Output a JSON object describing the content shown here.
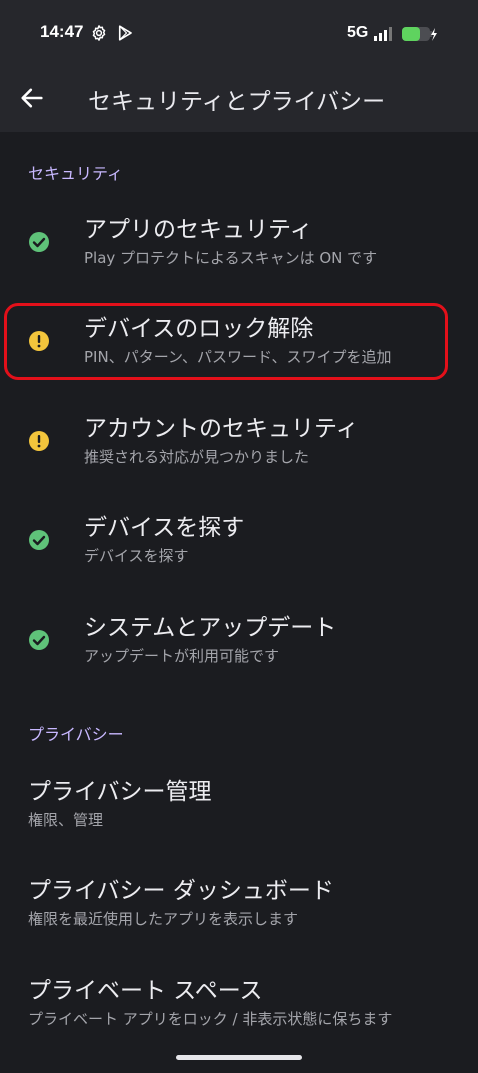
{
  "status_bar": {
    "time": "14:47",
    "network": "5G",
    "icons": [
      "settings-gear-icon",
      "play-store-icon",
      "signal-icon",
      "battery-charging-icon"
    ]
  },
  "app_bar": {
    "title": "セキュリティとプライバシー",
    "back_icon": "arrow-back-icon"
  },
  "security": {
    "header": "セキュリティ",
    "items": [
      {
        "label": "アプリのセキュリティ",
        "sub": "Play プロテクトによるスキャンは ON です",
        "status": "ok"
      },
      {
        "label": "デバイスのロック解除",
        "sub": "PIN、パターン、パスワード、スワイプを追加",
        "status": "warning"
      },
      {
        "label": "アカウントのセキュリティ",
        "sub": "推奨される対応が見つかりました",
        "status": "warning"
      },
      {
        "label": "デバイスを探す",
        "sub": "デバイスを探す",
        "status": "ok"
      },
      {
        "label": "システムとアップデート",
        "sub": "アップデートが利用可能です",
        "status": "ok"
      }
    ]
  },
  "privacy": {
    "header": "プライバシー",
    "items": [
      {
        "label": "プライバシー管理",
        "sub": "権限、管理"
      },
      {
        "label": "プライバシー ダッシュボード",
        "sub": "権限を最近使用したアプリを表示します"
      },
      {
        "label": "プライベート スペース",
        "sub": "プライベート アプリをロック / 非表示状態に保ちます"
      }
    ]
  },
  "colors": {
    "ok": "#5fc279",
    "warning": "#f3c53c",
    "highlight": "#e3101a",
    "accent": "#c8b8ff"
  }
}
